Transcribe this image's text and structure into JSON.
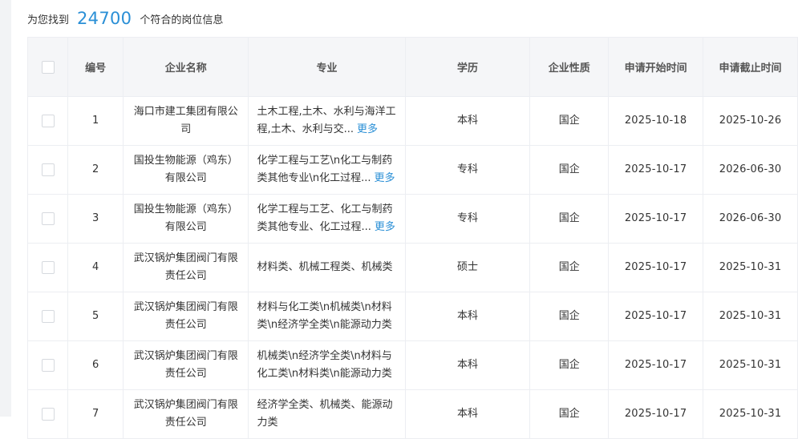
{
  "summary": {
    "prefix": "为您找到",
    "count": "24700",
    "suffix": "个符合的岗位信息"
  },
  "table": {
    "headers": {
      "select": "",
      "id": "编号",
      "company": "企业名称",
      "major": "专业",
      "education": "学历",
      "company_type": "企业性质",
      "start_date": "申请开始时间",
      "end_date": "申请截止时间"
    },
    "more_label": "更多",
    "rows": [
      {
        "id": "1",
        "company": "海口市建工集团有限公司",
        "major": "土木工程,土木、水利与海洋工程,土木、水利与交...",
        "has_more": true,
        "education": "本科",
        "company_type": "国企",
        "start_date": "2025-10-18",
        "end_date": "2025-10-26"
      },
      {
        "id": "2",
        "company": "国投生物能源（鸡东）有限公司",
        "major": "化学工程与工艺\\n化工与制药类其他专业\\n化工过程...",
        "has_more": true,
        "education": "专科",
        "company_type": "国企",
        "start_date": "2025-10-17",
        "end_date": "2026-06-30"
      },
      {
        "id": "3",
        "company": "国投生物能源（鸡东）有限公司",
        "major": "化学工程与工艺、化工与制药类其他专业、化工过程...",
        "has_more": true,
        "education": "专科",
        "company_type": "国企",
        "start_date": "2025-10-17",
        "end_date": "2026-06-30"
      },
      {
        "id": "4",
        "company": "武汉锅炉集团阀门有限责任公司",
        "major": "材料类、机械工程类、机械类",
        "has_more": false,
        "education": "硕士",
        "company_type": "国企",
        "start_date": "2025-10-17",
        "end_date": "2025-10-31"
      },
      {
        "id": "5",
        "company": "武汉锅炉集团阀门有限责任公司",
        "major": "材料与化工类\\n机械类\\n材料类\\n经济学全类\\n能源动力类",
        "has_more": false,
        "education": "本科",
        "company_type": "国企",
        "start_date": "2025-10-17",
        "end_date": "2025-10-31"
      },
      {
        "id": "6",
        "company": "武汉锅炉集团阀门有限责任公司",
        "major": "机械类\\n经济学全类\\n材料与化工类\\n材料类\\n能源动力类",
        "has_more": false,
        "education": "本科",
        "company_type": "国企",
        "start_date": "2025-10-17",
        "end_date": "2025-10-31"
      },
      {
        "id": "7",
        "company": "武汉锅炉集团阀门有限责任公司",
        "major": "经济学全类、机械类、能源动力类",
        "has_more": false,
        "education": "本科",
        "company_type": "国企",
        "start_date": "2025-10-17",
        "end_date": "2025-10-31"
      }
    ]
  }
}
